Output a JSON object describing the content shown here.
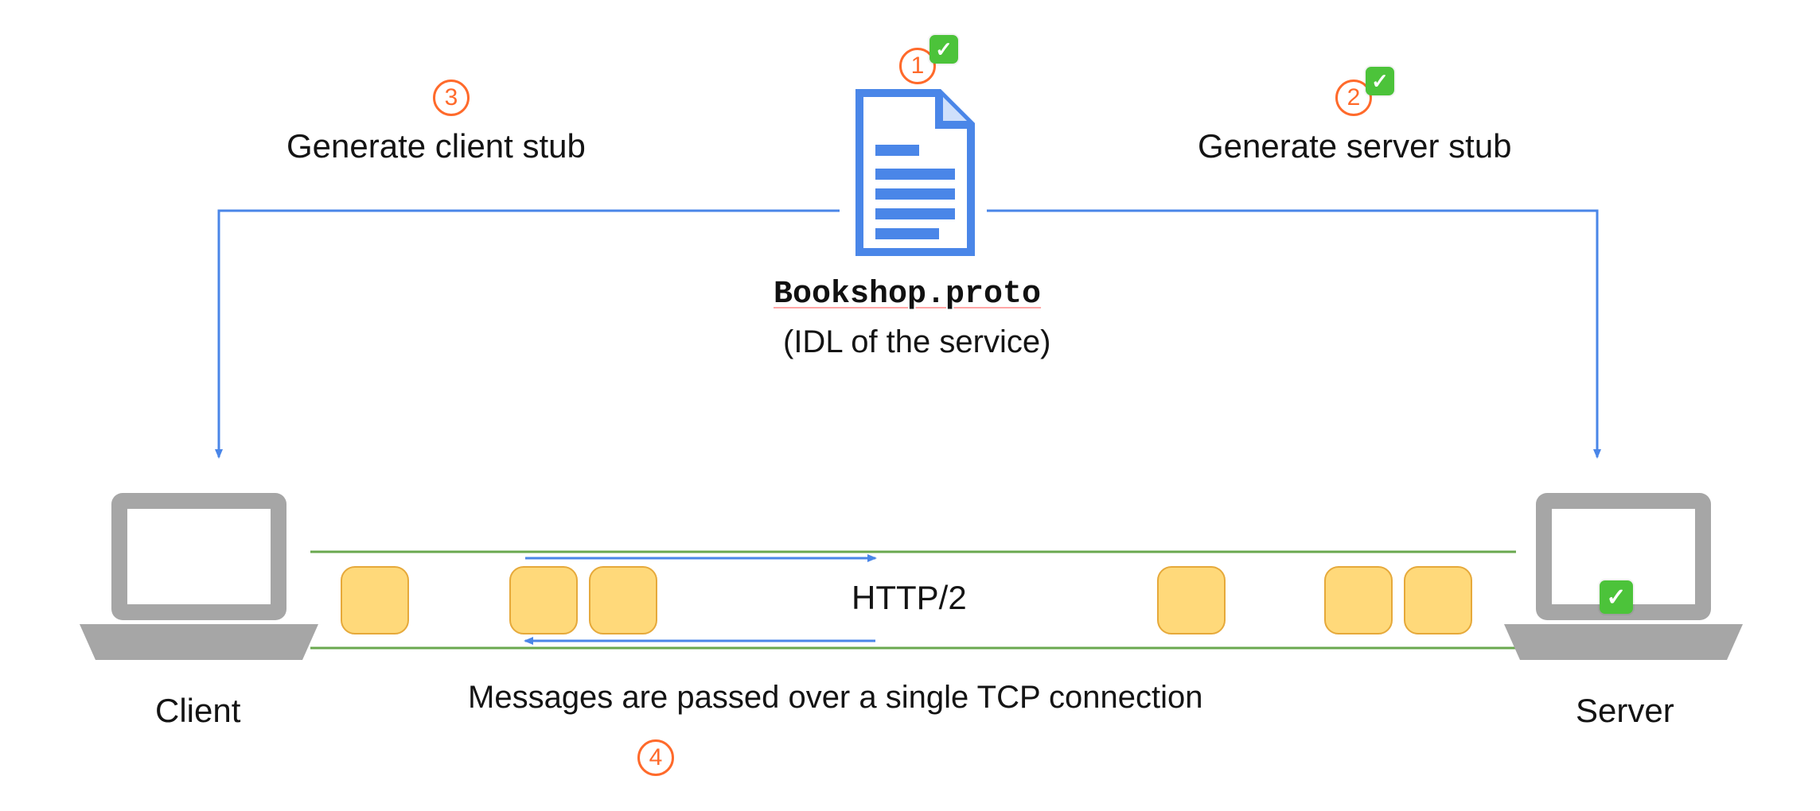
{
  "steps": {
    "s1": "1",
    "s2": "2",
    "s3": "3",
    "s4": "4"
  },
  "labels": {
    "client_stub": "Generate client stub",
    "server_stub": "Generate server stub",
    "proto_file": "Bookshop.proto",
    "idl_caption": "(IDL of the service)",
    "http2": "HTTP/2",
    "tcp_msg": "Messages are passed over a single TCP connection",
    "client": "Client",
    "server": "Server"
  },
  "colors": {
    "accent_blue": "#4a86e8",
    "line_green": "#6aa84f",
    "orange": "#ff6a2b",
    "packet_fill": "#ffd97a",
    "packet_border": "#e6a93a",
    "laptop": "#a6a6a6",
    "check_green": "#4cc33a"
  }
}
